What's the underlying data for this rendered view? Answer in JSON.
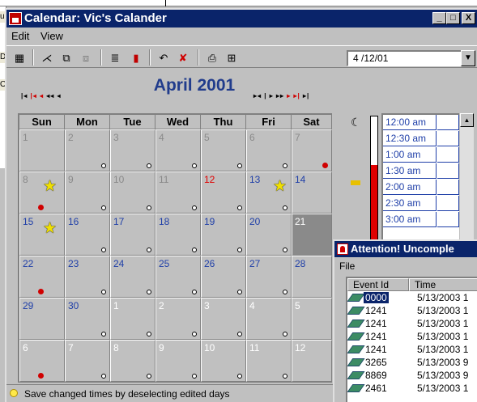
{
  "background_window": {
    "fragments": [
      "u",
      "De",
      "O"
    ]
  },
  "window": {
    "title": "Calendar: Vic's Calander",
    "controls": [
      "_",
      "□",
      "X"
    ]
  },
  "menu": {
    "items": [
      "Edit",
      "View"
    ]
  },
  "toolbar": {
    "icons": [
      "grid-view-icon",
      "magic-wand-icon",
      "copy-icon",
      "paste-icon",
      "list-icon",
      "book-icon",
      "undo-icon",
      "delete-icon",
      "print-icon",
      "print-preview-icon"
    ],
    "date_value": "4 /12/01",
    "dropdown_arrow": "▼"
  },
  "calendar": {
    "month_title": "April 2001",
    "nav_left": "◂◂ ◂◂ ◂ ◂◂ ◂",
    "nav_right": "▸◂ ▸ ▸▸ ▸ ▸▸ ▸",
    "day_headers": [
      "Sun",
      "Mon",
      "Tue",
      "Wed",
      "Thu",
      "Fri",
      "Sat"
    ],
    "weeks": [
      [
        {
          "n": "1",
          "s": "gray",
          "dot": false,
          "rdot": false,
          "star": false
        },
        {
          "n": "2",
          "s": "gray",
          "dot": true,
          "rdot": false,
          "star": false
        },
        {
          "n": "3",
          "s": "gray",
          "dot": true,
          "rdot": false,
          "star": false
        },
        {
          "n": "4",
          "s": "gray",
          "dot": true,
          "rdot": false,
          "star": false
        },
        {
          "n": "5",
          "s": "gray",
          "dot": true,
          "rdot": false,
          "star": false
        },
        {
          "n": "6",
          "s": "gray",
          "dot": true,
          "rdot": false,
          "star": false
        },
        {
          "n": "7",
          "s": "gray",
          "dot": false,
          "rdot": true,
          "star": false
        }
      ],
      [
        {
          "n": "8",
          "s": "gray",
          "dot": false,
          "rdot": true,
          "star": true
        },
        {
          "n": "9",
          "s": "gray",
          "dot": true,
          "rdot": false,
          "star": false
        },
        {
          "n": "10",
          "s": "gray",
          "dot": true,
          "rdot": false,
          "star": false
        },
        {
          "n": "11",
          "s": "gray",
          "dot": true,
          "rdot": false,
          "star": false
        },
        {
          "n": "12",
          "s": "red",
          "dot": true,
          "rdot": false,
          "star": false
        },
        {
          "n": "13",
          "s": "blue",
          "dot": true,
          "rdot": false,
          "star": true
        },
        {
          "n": "14",
          "s": "blue",
          "dot": false,
          "rdot": false,
          "star": false
        }
      ],
      [
        {
          "n": "15",
          "s": "blue",
          "dot": false,
          "rdot": false,
          "star": true
        },
        {
          "n": "16",
          "s": "blue",
          "dot": true,
          "rdot": false,
          "star": false
        },
        {
          "n": "17",
          "s": "blue",
          "dot": true,
          "rdot": false,
          "star": false
        },
        {
          "n": "18",
          "s": "blue",
          "dot": true,
          "rdot": false,
          "star": false
        },
        {
          "n": "19",
          "s": "blue",
          "dot": true,
          "rdot": false,
          "star": false
        },
        {
          "n": "20",
          "s": "blue",
          "dot": true,
          "rdot": false,
          "star": false
        },
        {
          "n": "21",
          "s": "other",
          "dot": false,
          "rdot": false,
          "star": false,
          "selected": true
        }
      ],
      [
        {
          "n": "22",
          "s": "blue",
          "dot": false,
          "rdot": true,
          "star": false
        },
        {
          "n": "23",
          "s": "blue",
          "dot": true,
          "rdot": false,
          "star": false
        },
        {
          "n": "24",
          "s": "blue",
          "dot": true,
          "rdot": false,
          "star": false
        },
        {
          "n": "25",
          "s": "blue",
          "dot": true,
          "rdot": false,
          "star": false
        },
        {
          "n": "26",
          "s": "blue",
          "dot": true,
          "rdot": false,
          "star": false
        },
        {
          "n": "27",
          "s": "blue",
          "dot": true,
          "rdot": false,
          "star": false
        },
        {
          "n": "28",
          "s": "blue",
          "dot": false,
          "rdot": false,
          "star": false
        }
      ],
      [
        {
          "n": "29",
          "s": "blue",
          "dot": false,
          "rdot": false,
          "star": false
        },
        {
          "n": "30",
          "s": "blue",
          "dot": true,
          "rdot": false,
          "star": false
        },
        {
          "n": "1",
          "s": "other",
          "dot": true,
          "rdot": false,
          "star": false
        },
        {
          "n": "2",
          "s": "other",
          "dot": true,
          "rdot": false,
          "star": false
        },
        {
          "n": "3",
          "s": "other",
          "dot": true,
          "rdot": false,
          "star": false
        },
        {
          "n": "4",
          "s": "other",
          "dot": true,
          "rdot": false,
          "star": false
        },
        {
          "n": "5",
          "s": "other",
          "dot": false,
          "rdot": false,
          "star": false
        }
      ],
      [
        {
          "n": "6",
          "s": "other",
          "dot": false,
          "rdot": true,
          "star": false
        },
        {
          "n": "7",
          "s": "other",
          "dot": true,
          "rdot": false,
          "star": false
        },
        {
          "n": "8",
          "s": "other",
          "dot": true,
          "rdot": false,
          "star": false
        },
        {
          "n": "9",
          "s": "other",
          "dot": true,
          "rdot": false,
          "star": false
        },
        {
          "n": "10",
          "s": "other",
          "dot": true,
          "rdot": false,
          "star": false
        },
        {
          "n": "11",
          "s": "other",
          "dot": true,
          "rdot": false,
          "star": false
        },
        {
          "n": "12",
          "s": "other",
          "dot": false,
          "rdot": false,
          "star": false
        }
      ]
    ]
  },
  "times": {
    "slots": [
      "12:00 am",
      "12:30 am",
      "1:00 am",
      "1:30 am",
      "2:00 am",
      "2:30 am",
      "3:00 am"
    ],
    "scroll_up": "▲"
  },
  "status": {
    "message": "Save changed times by deselecting edited days"
  },
  "attention": {
    "title": "Attention! Uncomple",
    "menu_file": "File",
    "columns": [
      "Event Id",
      "Time"
    ],
    "rows": [
      {
        "id": "0000",
        "time": "5/13/2003 1",
        "selected": true
      },
      {
        "id": "1241",
        "time": "5/13/2003 1",
        "selected": false
      },
      {
        "id": "1241",
        "time": "5/13/2003 1",
        "selected": false
      },
      {
        "id": "1241",
        "time": "5/13/2003 1",
        "selected": false
      },
      {
        "id": "1241",
        "time": "5/13/2003 1",
        "selected": false
      },
      {
        "id": "3265",
        "time": "5/13/2003 9",
        "selected": false
      },
      {
        "id": "8869",
        "time": "5/13/2003 9",
        "selected": false
      },
      {
        "id": "2461",
        "time": "5/13/2003 1",
        "selected": false
      }
    ]
  },
  "colors": {
    "titlebar": "#0a246a",
    "day_number": "#1f3fa8",
    "today": "#e00000",
    "month_title": "#213c8c"
  }
}
